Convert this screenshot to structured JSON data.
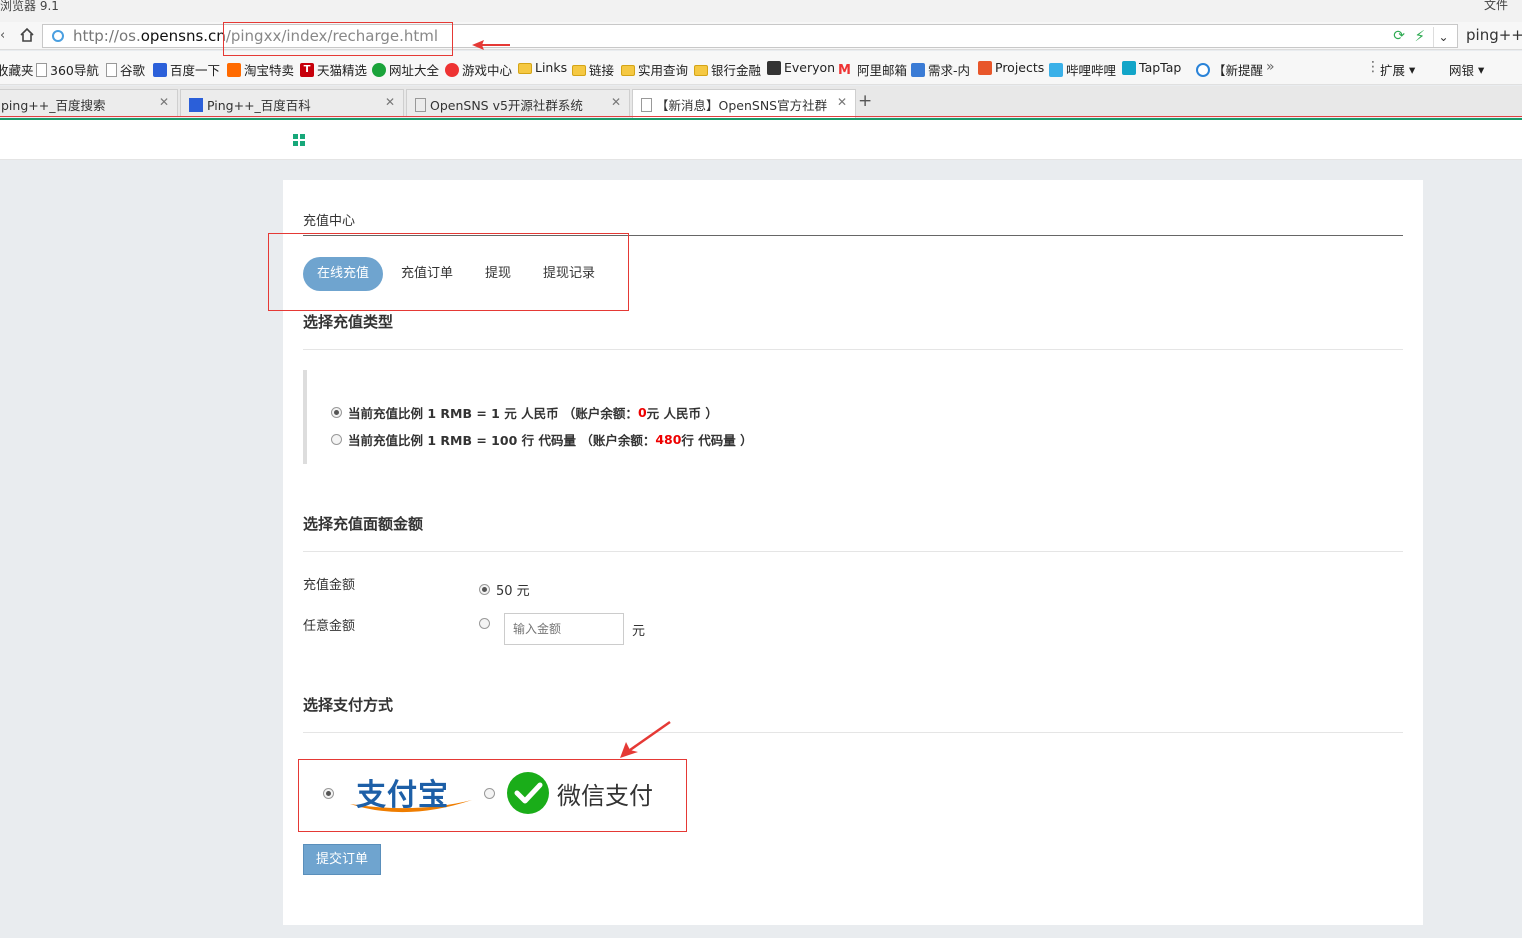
{
  "browser": {
    "title": "浏览器 9.1",
    "file_menu": "文件",
    "url_prefix": "http://os.",
    "url_domain": "opensns.cn",
    "url_path": "/pingxx/index/recharge.html",
    "search_text": "ping++"
  },
  "bookmarks": [
    {
      "label": "收藏夹",
      "icon": "star-icon"
    },
    {
      "label": "360导航",
      "icon": "page-icon"
    },
    {
      "label": "谷歌",
      "icon": "page-icon"
    },
    {
      "label": "百度一下",
      "icon": "baidu-icon"
    },
    {
      "label": "淘宝特卖",
      "icon": "taobao-icon"
    },
    {
      "label": "天猫精选",
      "icon": "tmall-icon"
    },
    {
      "label": "网址大全",
      "icon": "nav-icon"
    },
    {
      "label": "游戏中心",
      "icon": "game-icon"
    },
    {
      "label": "Links",
      "icon": "folder-icon"
    },
    {
      "label": "链接",
      "icon": "folder-icon"
    },
    {
      "label": "实用查询",
      "icon": "folder-icon"
    },
    {
      "label": "银行金融",
      "icon": "folder-icon"
    },
    {
      "label": "Everyon",
      "icon": "everyon-icon"
    },
    {
      "label": "阿里邮箱",
      "icon": "aliyun-mail-icon"
    },
    {
      "label": "需求-内",
      "icon": "wave-icon"
    },
    {
      "label": "Projects",
      "icon": "gitlab-icon"
    },
    {
      "label": "哔哩哔哩",
      "icon": "bilibili-icon"
    },
    {
      "label": "TapTap",
      "icon": "taptap-icon"
    },
    {
      "label": "【新提醒",
      "icon": "circle-icon"
    }
  ],
  "extensions": {
    "ext_label": "扩展",
    "bank_label": "网银"
  },
  "tabs": [
    {
      "label": "ping++_百度搜索"
    },
    {
      "label": "Ping++_百度百科"
    },
    {
      "label": "OpenSNS v5开源社群系统"
    },
    {
      "label": "【新消息】OpenSNS官方社群"
    }
  ],
  "page": {
    "title": "充值中心",
    "subtabs": [
      "在线充值",
      "充值订单",
      "提现",
      "提现记录"
    ],
    "section_type": "选择充值类型",
    "ratios": [
      {
        "prefix": "当前充值比例 1 RMB = 1 元 人民币 （账户余额：",
        "balance": "0",
        "suffix": " 元 人民币 ）",
        "checked": true
      },
      {
        "prefix": "当前充值比例 1 RMB = 100 行 代码量 （账户余额：",
        "balance": "480",
        "suffix": " 行 代码量 ）",
        "checked": false
      }
    ],
    "section_amount": "选择充值面额金额",
    "amount_label": "充值金额",
    "amount_option": "50 元",
    "custom_label": "任意金额",
    "custom_placeholder": "输入金额",
    "custom_unit": "元",
    "section_pay": "选择支付方式",
    "alipay_text": "支付宝",
    "wechat_text": "微信支付",
    "submit_label": "提交订单"
  },
  "colors": {
    "accent": "#6fa4cf",
    "highlight": "#e00000",
    "annotation": "#e53935",
    "site_green": "#17a87a"
  }
}
